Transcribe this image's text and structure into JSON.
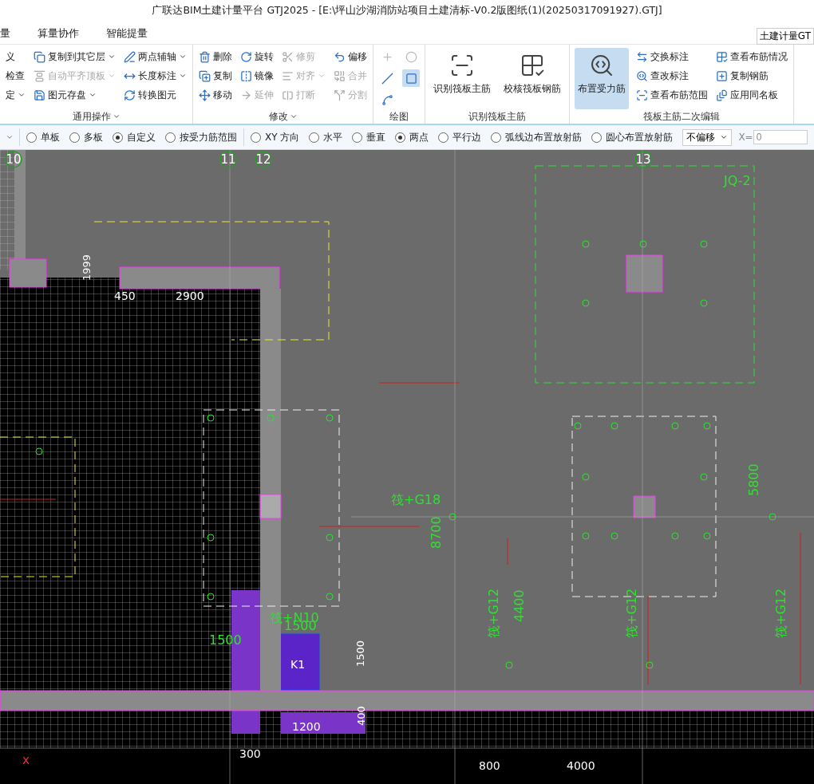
{
  "window": {
    "title": "广联达BIM土建计量平台 GTJ2025 - [E:\\坪山沙湖消防站项目土建清标-V0.2版图纸(1)(20250317091927).GTJ]"
  },
  "menu": [
    {
      "label": "量",
      "selected": false
    },
    {
      "label": "算量协作",
      "selected": false
    },
    {
      "label": "智能提量",
      "selected": false
    }
  ],
  "product_selector": {
    "value": "土建计量GT"
  },
  "ribbon": {
    "groups": [
      {
        "kind": "small",
        "title": "通用操作",
        "caret": true,
        "columns": [
          [
            {
              "label": "义",
              "dropdown": false,
              "disabled": false
            },
            {
              "label": "检查",
              "dropdown": false,
              "disabled": false
            },
            {
              "label": "定",
              "dropdown": true,
              "disabled": false
            }
          ],
          [
            {
              "label": "复制到其它层",
              "dropdown": true,
              "disabled": false
            },
            {
              "label": "自动平齐顶板",
              "dropdown": true,
              "disabled": true
            },
            {
              "label": "图元存盘",
              "dropdown": true,
              "disabled": false
            }
          ],
          [
            {
              "label": "两点辅轴",
              "dropdown": true,
              "disabled": false
            },
            {
              "label": "长度标注",
              "dropdown": true,
              "disabled": false
            },
            {
              "label": "转换图元",
              "dropdown": false,
              "disabled": false
            }
          ]
        ]
      },
      {
        "kind": "small",
        "title": "修改",
        "caret": true,
        "columns": [
          [
            {
              "label": "删除",
              "dropdown": false,
              "disabled": false
            },
            {
              "label": "复制",
              "dropdown": false,
              "disabled": false
            },
            {
              "label": "移动",
              "dropdown": false,
              "disabled": false
            }
          ],
          [
            {
              "label": "旋转",
              "dropdown": false,
              "disabled": false
            },
            {
              "label": "镜像",
              "dropdown": false,
              "disabled": false
            },
            {
              "label": "延伸",
              "dropdown": false,
              "disabled": true
            }
          ],
          [
            {
              "label": "修剪",
              "dropdown": false,
              "disabled": true
            },
            {
              "label": "对齐",
              "dropdown": true,
              "disabled": true
            },
            {
              "label": "打断",
              "dropdown": false,
              "disabled": true
            }
          ],
          [
            {
              "label": "偏移",
              "dropdown": false,
              "disabled": false
            },
            {
              "label": "合并",
              "dropdown": false,
              "disabled": true
            },
            {
              "label": "分割",
              "dropdown": false,
              "disabled": true
            }
          ]
        ]
      },
      {
        "kind": "draw",
        "title": "绘图",
        "caret": false,
        "tools": [
          {
            "kind": "point",
            "selected": false,
            "disabled": true
          },
          {
            "kind": "measure",
            "selected": false,
            "disabled": true
          },
          {
            "kind": "line",
            "selected": false,
            "disabled": false
          },
          {
            "kind": "rect",
            "selected": true,
            "disabled": false
          },
          {
            "kind": "arc",
            "selected": false,
            "disabled": false
          }
        ]
      },
      {
        "kind": "large",
        "title": "识别筏板主筋",
        "caret": false,
        "buttons": [
          {
            "label": "识别筏板主筋",
            "selected": false
          },
          {
            "label": "校核筏板钢筋",
            "selected": false
          }
        ]
      },
      {
        "kind": "mixed",
        "title": "筏板主筋二次编辑",
        "caret": false,
        "buttons": [
          {
            "label": "布置受力筋",
            "selected": true
          }
        ],
        "columns": [
          [
            {
              "label": "交换标注",
              "dropdown": false,
              "disabled": false
            },
            {
              "label": "查改标注",
              "dropdown": false,
              "disabled": false
            },
            {
              "label": "查看布筋范围",
              "dropdown": false,
              "disabled": false
            }
          ],
          [
            {
              "label": "查看布筋情况",
              "dropdown": false,
              "disabled": false
            },
            {
              "label": "复制钢筋",
              "dropdown": false,
              "disabled": false
            },
            {
              "label": "应用同名板",
              "dropdown": false,
              "disabled": false
            }
          ]
        ]
      }
    ]
  },
  "options": {
    "groups": [
      [
        {
          "label": "单板",
          "selected": false
        },
        {
          "label": "多板",
          "selected": false
        },
        {
          "label": "自定义",
          "selected": true
        },
        {
          "label": "按受力筋范围",
          "selected": false
        }
      ],
      [
        {
          "label": "XY 方向",
          "selected": false
        },
        {
          "label": "水平",
          "selected": false
        },
        {
          "label": "垂直",
          "selected": false
        },
        {
          "label": "两点",
          "selected": true
        },
        {
          "label": "平行边",
          "selected": false
        },
        {
          "label": "弧线边布置放射筋",
          "selected": false
        },
        {
          "label": "圆心布置放射筋",
          "selected": false
        }
      ]
    ],
    "offset": {
      "value": "不偏移"
    },
    "x_label": "X=",
    "x_value": "0"
  },
  "cad": {
    "labels": [
      {
        "text": "10",
        "kind": "axis"
      },
      {
        "text": "11",
        "kind": "axis"
      },
      {
        "text": "12",
        "kind": "axis"
      },
      {
        "text": "13",
        "kind": "axis"
      },
      {
        "text": "JQ-2",
        "kind": "rebar"
      },
      {
        "text": "1999",
        "kind": "dim_v"
      },
      {
        "text": "450",
        "kind": "dim"
      },
      {
        "text": "2900",
        "kind": "dim"
      },
      {
        "text": "筏+G18",
        "kind": "rebar"
      },
      {
        "text": "8700",
        "kind": "rebar_v"
      },
      {
        "text": "5800",
        "kind": "rebar_v"
      },
      {
        "text": "4400",
        "kind": "rebar_v"
      },
      {
        "text": "筏+G12",
        "kind": "rebar_v"
      },
      {
        "text": "筏+G12",
        "kind": "rebar_v"
      },
      {
        "text": "筏+G12",
        "kind": "rebar_v"
      },
      {
        "text": "筏+N10",
        "kind": "rebar"
      },
      {
        "text": "1500",
        "kind": "rebar"
      },
      {
        "text": "1500",
        "kind": "rebar"
      },
      {
        "text": "K1",
        "kind": "dim"
      },
      {
        "text": "1500",
        "kind": "dim_v"
      },
      {
        "text": "1200",
        "kind": "dim"
      },
      {
        "text": "400",
        "kind": "dim_v"
      },
      {
        "text": "300",
        "kind": "dim"
      },
      {
        "text": "800",
        "kind": "dim"
      },
      {
        "text": "4000",
        "kind": "dim"
      },
      {
        "text": "X",
        "kind": "axis_mark"
      }
    ]
  }
}
